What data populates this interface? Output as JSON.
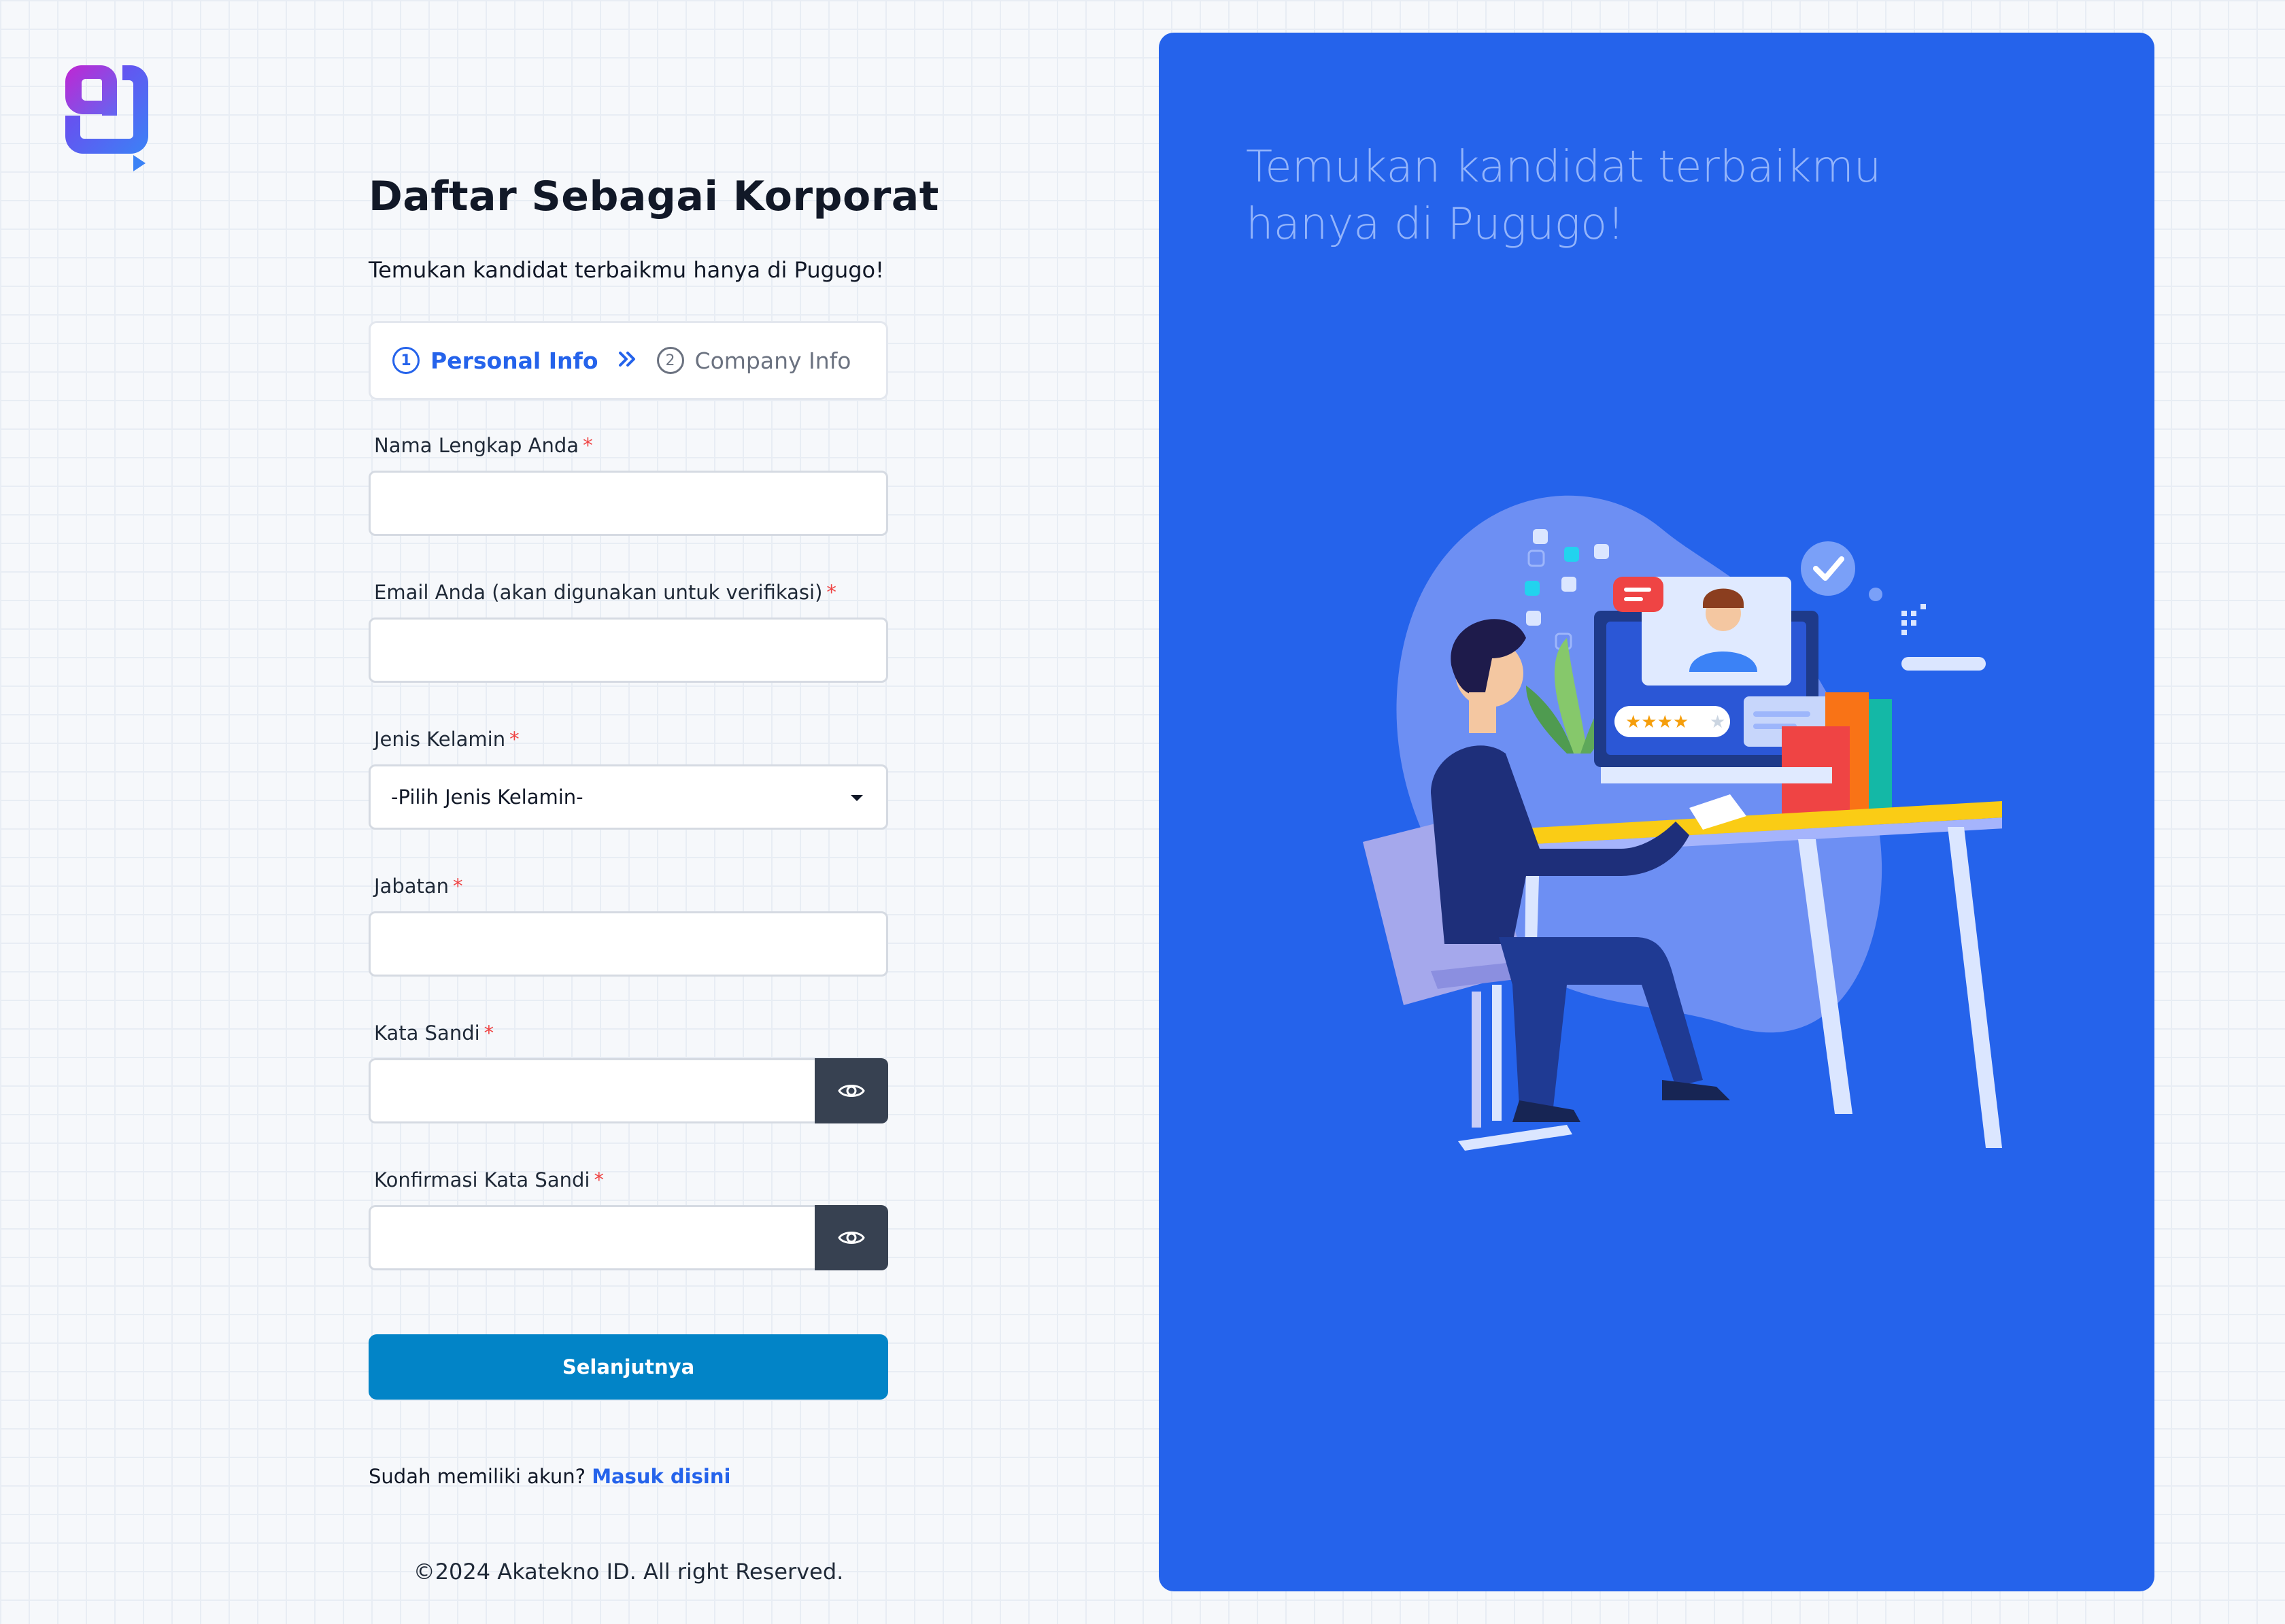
{
  "brand": {
    "logo_icon": "pugugo-logo-icon"
  },
  "header": {
    "title": "Daftar Sebagai Korporat",
    "subtitle": "Temukan kandidat terbaikmu hanya di Pugugo!"
  },
  "steps": [
    {
      "number": "1",
      "label": "Personal Info",
      "active": true
    },
    {
      "number": "2",
      "label": "Company Info",
      "active": false
    }
  ],
  "steps_separator_icon": "double-chevron-right-icon",
  "form": {
    "full_name": {
      "label": "Nama Lengkap Anda",
      "required": "*",
      "value": ""
    },
    "email": {
      "label": "Email Anda (akan digunakan untuk verifikasi)",
      "required": "*",
      "value": ""
    },
    "gender": {
      "label": "Jenis Kelamin",
      "required": "*",
      "selected": "-Pilih Jenis Kelamin-"
    },
    "position": {
      "label": "Jabatan",
      "required": "*",
      "value": ""
    },
    "password": {
      "label": "Kata Sandi",
      "required": "*",
      "value": "",
      "toggle_icon": "eye-icon"
    },
    "confirm_password": {
      "label": "Konfirmasi Kata Sandi",
      "required": "*",
      "value": "",
      "toggle_icon": "eye-icon"
    },
    "submit_label": "Selanjutnya"
  },
  "login_prompt": {
    "text": "Sudah memiliki akun?",
    "link": "Masuk disini"
  },
  "footer": "©2024 Akatekno ID. All right Reserved.",
  "panel": {
    "headline": "Temukan kandidat terbaikmu hanya di Pugugo!",
    "illustration": "recruiter-video-call-illustration",
    "background": "#2563eb"
  },
  "colors": {
    "accent": "#2563eb",
    "submit": "#0284c7",
    "required": "#ef4444",
    "eye_button": "#374151"
  }
}
